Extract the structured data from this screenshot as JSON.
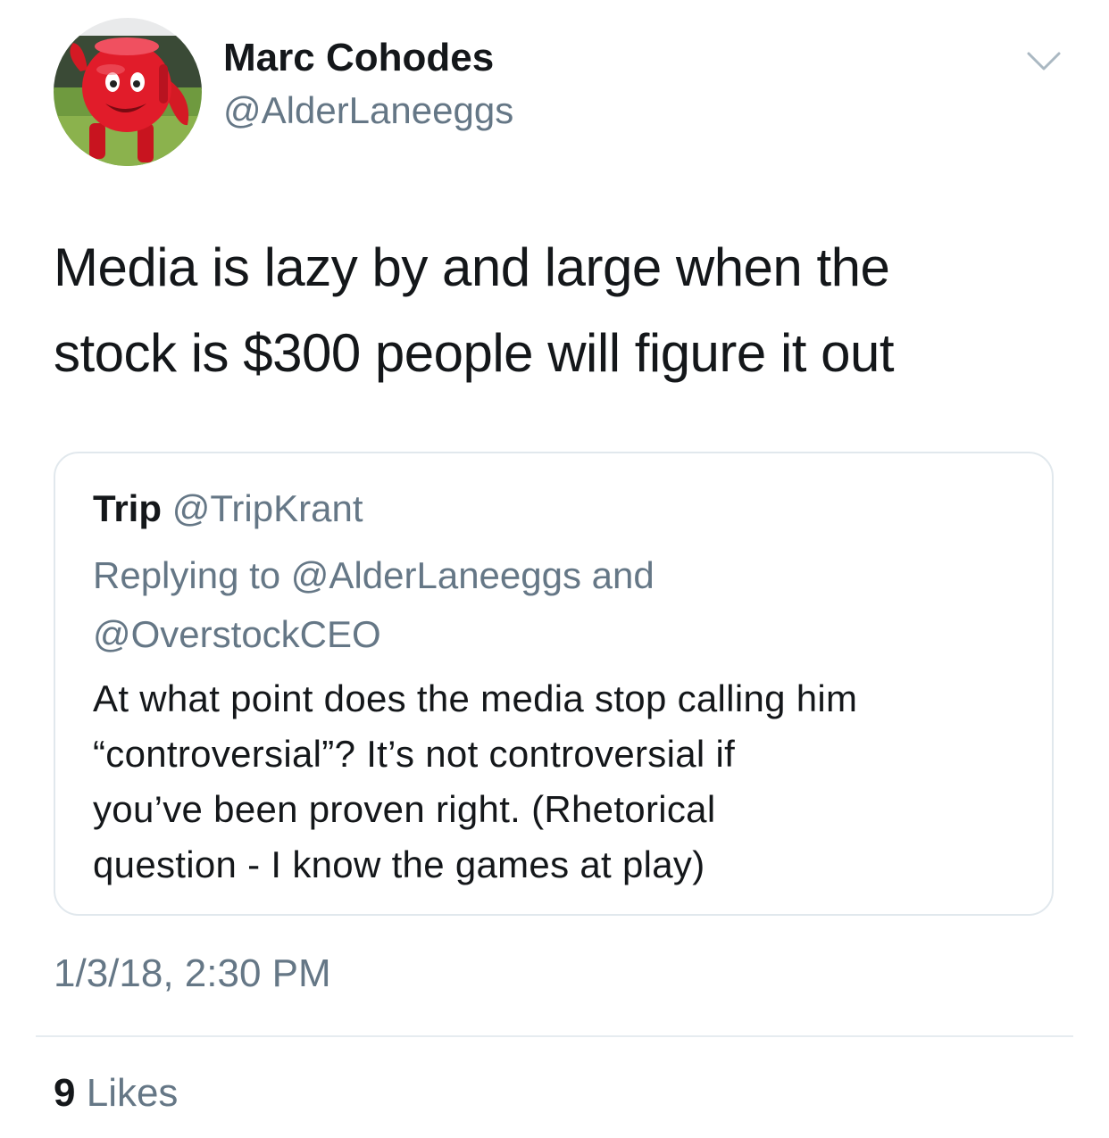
{
  "tweet": {
    "author": {
      "display_name": "Marc Cohodes",
      "handle": "@AlderLaneeggs",
      "avatar_icon": "kool-aid-man-avatar"
    },
    "menu_icon": "chevron-down-icon",
    "text_lines": [
      "Media is lazy by and large when the",
      "stock is $300 people will figure it out"
    ],
    "timestamp": "1/3/18, 2:30 PM",
    "likes_count": "9",
    "likes_label": "Likes"
  },
  "quoted_tweet": {
    "display_name": "Trip",
    "handle": "@TripKrant",
    "replying_lines": [
      "Replying to @AlderLaneeggs and",
      "@OverstockCEO"
    ],
    "body_lines": [
      "At what point does the media stop calling him",
      "“controversial”?  It’s not controversial if",
      "you’ve been proven right.  (Rhetorical",
      "question - I know the games at play)"
    ]
  },
  "colors": {
    "primary_text": "#14171a",
    "secondary_text": "#657786",
    "border": "#e1e8ed",
    "avatar_red": "#d9182a"
  }
}
